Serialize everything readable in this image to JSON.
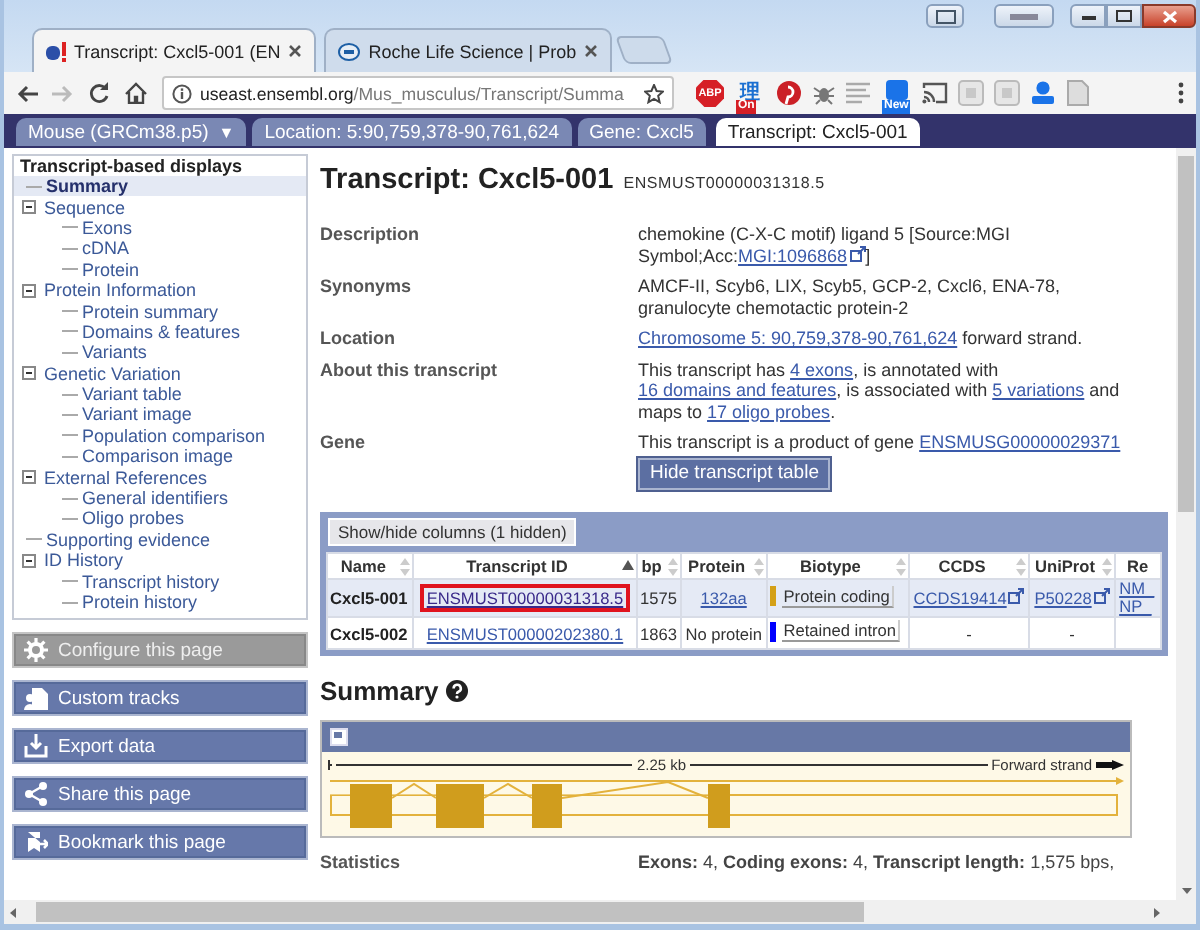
{
  "browser": {
    "tabs": [
      {
        "title": "Transcript: Cxcl5-001 (EN",
        "selected": true
      },
      {
        "title": "Roche Life Science | Prob",
        "selected": false
      }
    ],
    "address": {
      "host": "useast.ensembl.org",
      "path": "/Mus_musculus/Transcript/Summa"
    },
    "extensions": [
      {
        "kind": "abp",
        "label": "ABP"
      },
      {
        "kind": "translate",
        "glyph": "理",
        "label": "On"
      },
      {
        "kind": "pin"
      },
      {
        "kind": "bug"
      },
      {
        "kind": "lines"
      },
      {
        "kind": "news",
        "label": "New"
      },
      {
        "kind": "cast"
      },
      {
        "kind": "grey"
      },
      {
        "kind": "grey"
      },
      {
        "kind": "person"
      },
      {
        "kind": "pdf"
      }
    ]
  },
  "site_nav": {
    "species": "Mouse (GRCm38.p5)",
    "species_caret": "▼",
    "tabs": [
      {
        "label": "Location: 5:90,759,378-90,761,624",
        "selected": false
      },
      {
        "label": "Gene: Cxcl5",
        "selected": false
      },
      {
        "label": "Transcript: Cxcl5-001",
        "selected": true
      }
    ]
  },
  "sidebar": {
    "title": "Transcript-based displays",
    "items": [
      {
        "label": "Summary",
        "selected": true
      },
      {
        "label": "Sequence",
        "selected": false,
        "expanded": true,
        "children": [
          {
            "label": "Exons",
            "selected": false
          },
          {
            "label": "cDNA",
            "selected": false
          },
          {
            "label": "Protein",
            "selected": false
          }
        ]
      },
      {
        "label": "Protein Information",
        "selected": false,
        "expanded": true,
        "children": [
          {
            "label": "Protein summary",
            "selected": false
          },
          {
            "label": "Domains & features",
            "selected": false
          },
          {
            "label": "Variants",
            "selected": false
          }
        ]
      },
      {
        "label": "Genetic Variation",
        "selected": false,
        "expanded": true,
        "children": [
          {
            "label": "Variant table",
            "selected": false
          },
          {
            "label": "Variant image",
            "selected": false
          },
          {
            "label": "Population comparison",
            "selected": false
          },
          {
            "label": "Comparison image",
            "selected": false
          }
        ]
      },
      {
        "label": "External References",
        "selected": false,
        "expanded": true,
        "children": [
          {
            "label": "General identifiers",
            "selected": false
          },
          {
            "label": "Oligo probes",
            "selected": false
          }
        ]
      },
      {
        "label": "Supporting evidence",
        "selected": false
      },
      {
        "label": "ID History",
        "selected": false,
        "expanded": true,
        "children": [
          {
            "label": "Transcript history",
            "selected": false
          },
          {
            "label": "Protein history",
            "selected": false
          }
        ]
      }
    ],
    "actions": [
      {
        "kind": "configure",
        "label": "Configure this page",
        "disabled": true
      },
      {
        "kind": "custom-tracks",
        "label": "Custom tracks",
        "disabled": false
      },
      {
        "kind": "export",
        "label": "Export data",
        "disabled": false
      },
      {
        "kind": "share",
        "label": "Share this page",
        "disabled": false
      },
      {
        "kind": "bookmark",
        "label": "Bookmark this page",
        "disabled": false
      }
    ]
  },
  "main": {
    "title": "Transcript: Cxcl5-001",
    "subtitle": "ENSMUST00000031318.5",
    "details": [
      {
        "label": "Description",
        "value": [
          {
            "kind": "text",
            "text": "chemokine (C-X-C motif) ligand 5 [Source:MGI Symbol;Acc:"
          },
          {
            "kind": "external",
            "text": "MGI:1096868"
          },
          {
            "kind": "text",
            "text": "]"
          }
        ]
      },
      {
        "label": "Synonyms",
        "value": [
          {
            "kind": "text",
            "text": "AMCF-II, Scyb6, LIX, Scyb5, GCP-2, Cxcl6, ENA-78, granulocyte chemotactic protein-2"
          }
        ]
      },
      {
        "label": "Location",
        "value": [
          {
            "kind": "link",
            "text": "Chromosome 5: 90,759,378-90,761,624"
          },
          {
            "kind": "text",
            "text": " forward strand."
          }
        ]
      },
      {
        "label": "About this transcript",
        "value": [
          {
            "kind": "text",
            "text": "This transcript has "
          },
          {
            "kind": "link",
            "text": "4 exons"
          },
          {
            "kind": "text",
            "text": ", is annotated with "
          },
          {
            "kind": "link",
            "text": "16 domains and features"
          },
          {
            "kind": "text",
            "text": ", is associated with "
          },
          {
            "kind": "link",
            "text": "5 variations"
          },
          {
            "kind": "text",
            "text": " and maps to "
          },
          {
            "kind": "link",
            "text": "17 oligo probes"
          },
          {
            "kind": "text",
            "text": "."
          }
        ]
      },
      {
        "label": "Gene",
        "value": [
          {
            "kind": "text",
            "text": "This transcript is a product of gene "
          },
          {
            "kind": "link",
            "text": "ENSMUSG00000029371"
          }
        ],
        "button": "Hide transcript table"
      }
    ],
    "table": {
      "toolbar_button": "Show/hide columns (1 hidden)",
      "columns": [
        {
          "label": "Name",
          "sorted": false
        },
        {
          "label": "Transcript ID",
          "sorted": true
        },
        {
          "label": "bp",
          "sorted": false
        },
        {
          "label": "Protein",
          "sorted": false
        },
        {
          "label": "Biotype",
          "sorted": false
        },
        {
          "label": "CCDS",
          "sorted": false
        },
        {
          "label": "UniProt",
          "sorted": false
        },
        {
          "label": "Re"
        }
      ],
      "rows": [
        {
          "selected": true,
          "cells": [
            {
              "kind": "bold",
              "text": "Cxcl5-001"
            },
            {
              "kind": "link",
              "text": "ENSMUST00000031318.5",
              "highlighted": true
            },
            {
              "kind": "text",
              "text": "1575"
            },
            {
              "kind": "link",
              "text": "132aa"
            },
            {
              "kind": "biotype",
              "text": "Protein coding",
              "color": "#d4a017"
            },
            {
              "kind": "external",
              "text": "CCDS19414"
            },
            {
              "kind": "external",
              "text": "P50228"
            },
            {
              "kind": "links",
              "lines": [
                "NM_",
                "NP_"
              ]
            }
          ]
        },
        {
          "selected": false,
          "cells": [
            {
              "kind": "bold",
              "text": "Cxcl5-002"
            },
            {
              "kind": "link",
              "text": "ENSMUST00000202380.1",
              "highlighted": false
            },
            {
              "kind": "text",
              "text": "1863"
            },
            {
              "kind": "text",
              "text": "No protein"
            },
            {
              "kind": "biotype",
              "text": "Retained intron",
              "color": "#0000ff"
            },
            {
              "kind": "text",
              "text": "-"
            },
            {
              "kind": "text",
              "text": "-"
            }
          ]
        }
      ]
    },
    "summary": {
      "title": "Summary",
      "image": {
        "scale": "2.25 kb",
        "strand": "Forward strand"
      },
      "stats_label": "Statistics",
      "stats": "**Exons:** 4, **Coding exons:** 4, **Transcript length:** 1,575 bps,"
    }
  }
}
